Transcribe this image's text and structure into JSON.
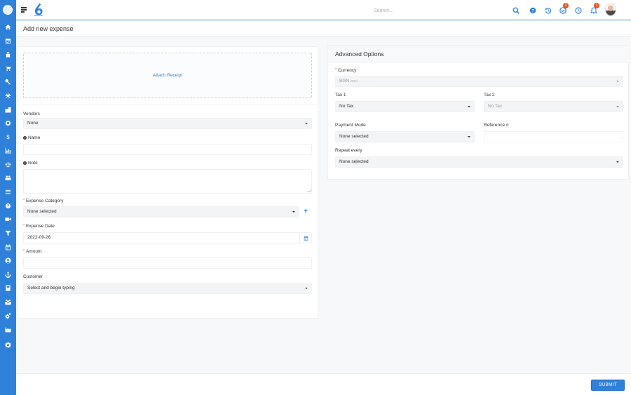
{
  "header": {
    "search_placeholder": "Search...",
    "tasks_badge": "3",
    "notifications_badge": "1"
  },
  "page": {
    "title": "Add new expense"
  },
  "left": {
    "attach_receipt": "Attach Receipt",
    "vendors_label": "Vendors",
    "vendors_value": "None",
    "name_label": "Name",
    "note_label": "Note",
    "expense_category_label": "Expense Category",
    "expense_category_value": "None selected",
    "expense_date_label": "Expense Date",
    "expense_date_value": "2022-09-26",
    "amount_label": "Amount",
    "customer_label": "Customer",
    "customer_value": "Select and begin typing"
  },
  "advanced": {
    "title": "Advanced Options",
    "currency_label": "Currency",
    "currency_value": "BGN",
    "currency_suffix": "BGN",
    "tax1_label": "Tax 1",
    "tax1_value": "No Tax",
    "tax2_label": "Tax 2",
    "tax2_value": "No Tax",
    "payment_mode_label": "Payment Mode",
    "payment_mode_value": "None selected",
    "reference_label": "Reference #",
    "repeat_label": "Repeat every",
    "repeat_value": "None selected"
  },
  "footer": {
    "submit_label": "SUBMIT"
  },
  "colors": {
    "sidebar": "#2f80d9",
    "accent": "#2f80d9",
    "badge": "#e2572b",
    "required": "#d9534f"
  },
  "sidebar_icons": [
    "home-icon",
    "calendar-check-icon",
    "lock-icon",
    "cart-icon",
    "key-icon",
    "snowflake-icon",
    "building-icon",
    "circle-icon",
    "dollar-icon",
    "bar-chart-icon",
    "scale-icon",
    "users-icon",
    "list-icon",
    "help-icon",
    "video-icon",
    "filter-icon",
    "calendar-icon",
    "user-circle-icon",
    "anchor-icon",
    "book-icon",
    "groups-icon",
    "cogs-icon",
    "factory-icon",
    "settings-icon"
  ]
}
